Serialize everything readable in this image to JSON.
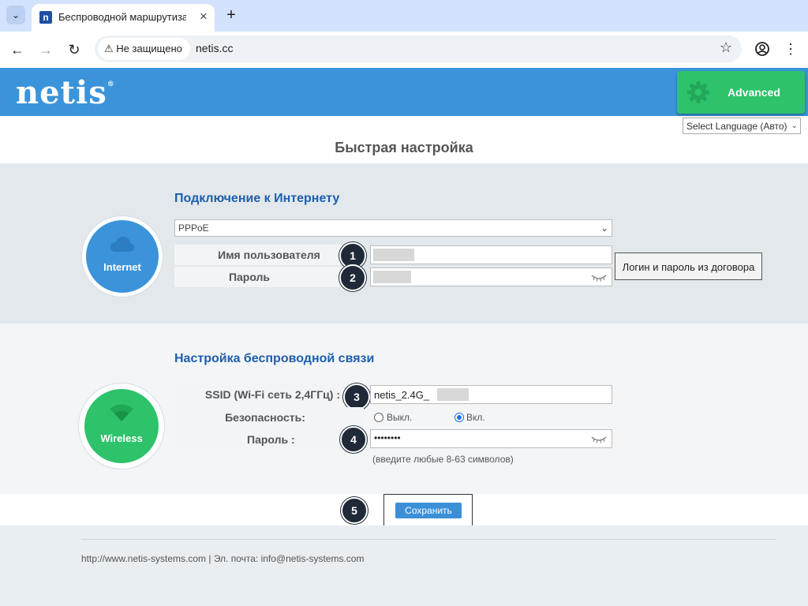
{
  "browser": {
    "tab_title": "Беспроводной маршрутизатор",
    "tab_favicon": "n",
    "security_text": "Не защищено",
    "url": "netis.cc"
  },
  "header": {
    "logo": "netis",
    "logo_mark": "®",
    "advanced_label": "Advanced",
    "language_value": "Select Language (Авто)"
  },
  "page_title": "Быстрая настройка",
  "internet": {
    "icon_label": "Internet",
    "heading": "Подключение к Интернету",
    "connection_type": "PPPoE",
    "username_label": "Имя пользователя",
    "password_label": "Пароль",
    "contract_button": "Логин и пароль из договора"
  },
  "wireless": {
    "icon_label": "Wireless",
    "heading": "Настройка беспроводной связи",
    "ssid_label": "SSID (Wi-Fi сеть 2,4ГГц) :",
    "ssid_value": "netis_2.4G_",
    "security_label": "Безопасность:",
    "security_off": "Выкл.",
    "security_on": "Вкл.",
    "security_selected": "on",
    "password_label": "Пароль :",
    "password_mask": "••••••••",
    "password_hint": "(введите любые 8-63 символов)"
  },
  "badges": [
    "1",
    "2",
    "3",
    "4",
    "5"
  ],
  "save_label": "Сохранить",
  "footer_text": "http://www.netis-systems.com | Эл. почта: info@netis-systems.com",
  "colors": {
    "header_blue": "#3b94d9",
    "advanced_green": "#2ec26b",
    "internet_blue": "#3b94d9",
    "wireless_green": "#2ec26b",
    "heading_blue": "#1d5fad"
  }
}
